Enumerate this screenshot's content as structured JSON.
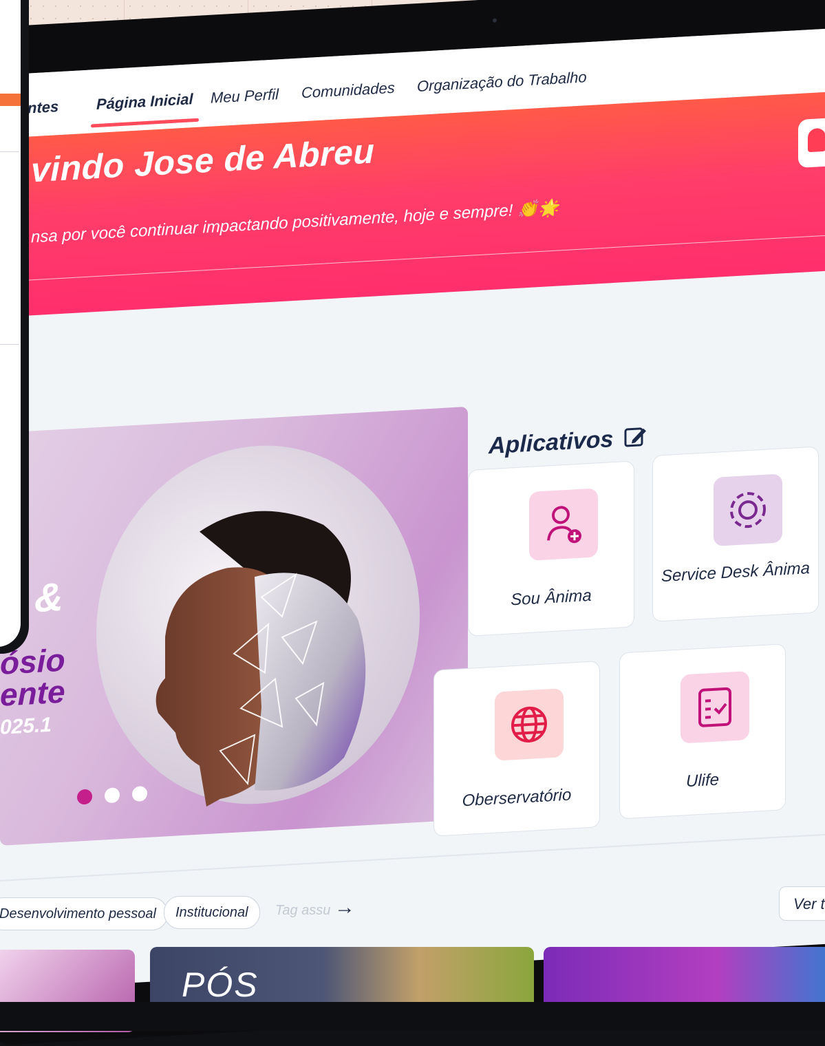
{
  "nav": {
    "items": [
      {
        "label": "ntes",
        "active": false
      },
      {
        "label": "Página Inicial",
        "active": true
      },
      {
        "label": "Meu Perfil",
        "active": false
      },
      {
        "label": "Comunidades",
        "active": false
      },
      {
        "label": "Organização do Trabalho",
        "active": false
      }
    ]
  },
  "hero": {
    "title": "vindo Jose de Abreu",
    "subtitle": "nsa por você continuar impactando positivamente, hoje e sempre! 👏🌟",
    "gradient_top": "#ff5a48",
    "gradient_bottom": "#ff2e6c"
  },
  "carousel": {
    "line_ampersand": "&",
    "line1": "ósio",
    "line2": "ente",
    "line3": "025.1",
    "active_slide": 1,
    "slide_count": 3
  },
  "apps": {
    "title": "Aplicativos",
    "items": [
      {
        "label": "Sou Ânima",
        "icon": "user-add-icon",
        "bg": "#fbd3e6",
        "fg": "#c1127a"
      },
      {
        "label": "Service Desk Ânima",
        "icon": "gear-icon",
        "bg": "#e7d2ec",
        "fg": "#7a2a8f"
      },
      {
        "label": "Oberservatório",
        "icon": "globe-icon",
        "bg": "#fdd6d8",
        "fg": "#e11d48"
      },
      {
        "label": "Ulife",
        "icon": "checklist-icon",
        "bg": "#fbd3e6",
        "fg": "#c1127a"
      }
    ]
  },
  "tags": {
    "items": [
      "Desenvolvimento pessoal",
      "Institucional"
    ],
    "input_placeholder": "Tag assu",
    "see_all": "Ver to"
  },
  "news": {
    "thumb2_text": "PÓS"
  }
}
